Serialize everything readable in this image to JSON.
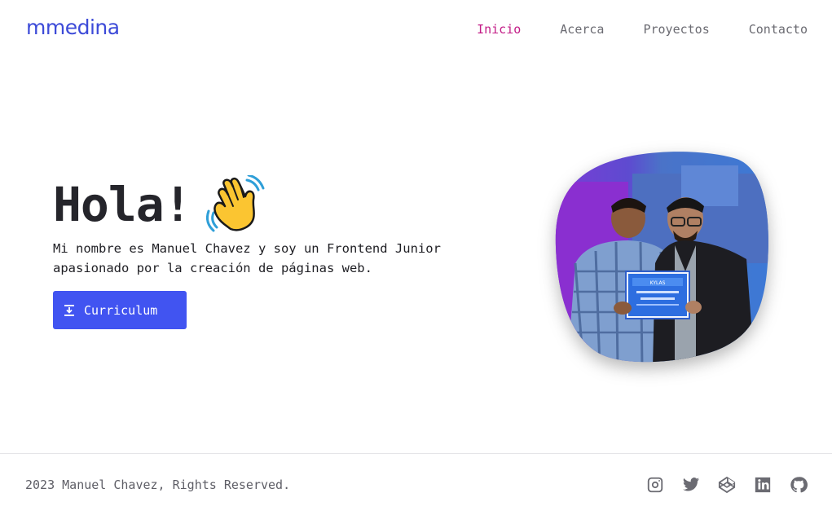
{
  "header": {
    "logo": "mmedina",
    "nav": [
      {
        "label": "Inicio",
        "active": true
      },
      {
        "label": "Acerca",
        "active": false
      },
      {
        "label": "Proyectos",
        "active": false
      },
      {
        "label": "Contacto",
        "active": false
      }
    ]
  },
  "hero": {
    "greeting": "Hola!",
    "greeting_icon": "waving-hand-icon",
    "description": "Mi nombre es Manuel Chavez y soy un Frontend Junior apasionado por la creación de páginas web.",
    "button_label": "Curriculum",
    "button_icon": "download-icon",
    "photo": {
      "description_icon": "profile-photo",
      "certificate_header": "KYLAS"
    }
  },
  "footer": {
    "copyright": "2023 Manuel Chavez, Rights Reserved.",
    "socials": [
      "instagram-icon",
      "twitter-icon",
      "codepen-icon",
      "linkedin-icon",
      "github-icon"
    ]
  },
  "colors": {
    "brand": "#3d4bd8",
    "nav_active": "#c21b86",
    "button": "#4154f1",
    "text": "#1f1f24",
    "muted": "#6b6b72"
  }
}
